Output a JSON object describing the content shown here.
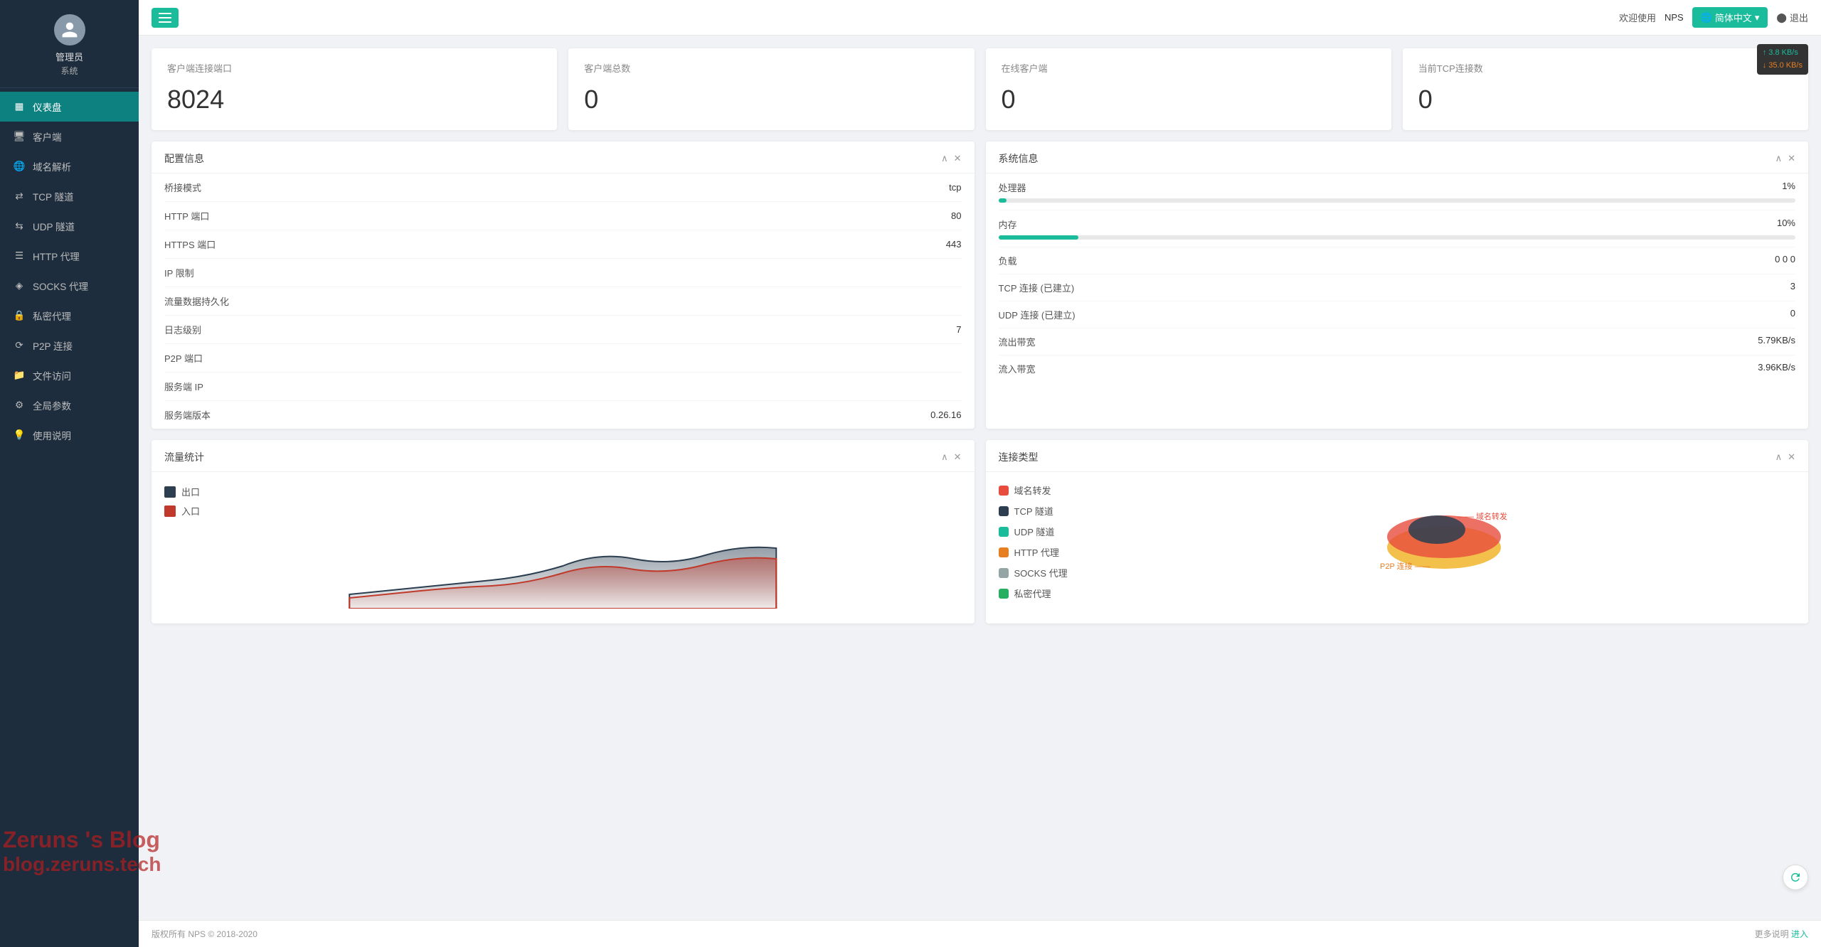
{
  "sidebar": {
    "user": {
      "name": "管理员",
      "role": "系统"
    },
    "nav": [
      {
        "id": "dashboard",
        "label": "仪表盘",
        "icon": "dashboard",
        "active": true
      },
      {
        "id": "clients",
        "label": "客户端",
        "icon": "clients",
        "active": false
      },
      {
        "id": "dns",
        "label": "域名解析",
        "icon": "dns",
        "active": false
      },
      {
        "id": "tcp",
        "label": "TCP 隧道",
        "icon": "tcp",
        "active": false
      },
      {
        "id": "udp",
        "label": "UDP 隧道",
        "icon": "udp",
        "active": false
      },
      {
        "id": "http",
        "label": "HTTP 代理",
        "icon": "http",
        "active": false
      },
      {
        "id": "socks",
        "label": "SOCKS 代理",
        "icon": "socks",
        "active": false
      },
      {
        "id": "private",
        "label": "私密代理",
        "icon": "private",
        "active": false
      },
      {
        "id": "p2p",
        "label": "P2P 连接",
        "icon": "p2p",
        "active": false
      },
      {
        "id": "file",
        "label": "文件访问",
        "icon": "file",
        "active": false
      },
      {
        "id": "global",
        "label": "全局参数",
        "icon": "global",
        "active": false
      },
      {
        "id": "docs",
        "label": "使用说明",
        "icon": "docs",
        "active": false
      }
    ]
  },
  "topbar": {
    "welcome": "欢迎使用",
    "brand": "NPS",
    "lang": "简体中文",
    "logout": "退出",
    "toggle_label": "菜单"
  },
  "stats": [
    {
      "label": "客户端连接端口",
      "value": "8024"
    },
    {
      "label": "客户端总数",
      "value": "0"
    },
    {
      "label": "在线客户端",
      "value": "0"
    },
    {
      "label": "当前TCP连接数",
      "value": "0"
    }
  ],
  "config": {
    "title": "配置信息",
    "rows": [
      {
        "key": "桥接模式",
        "value": "tcp"
      },
      {
        "key": "HTTP 端口",
        "value": "80"
      },
      {
        "key": "HTTPS 端口",
        "value": "443"
      },
      {
        "key": "IP 限制",
        "value": ""
      },
      {
        "key": "流量数据持久化",
        "value": ""
      },
      {
        "key": "日志级别",
        "value": "7"
      },
      {
        "key": "P2P 端口",
        "value": ""
      },
      {
        "key": "服务端 IP",
        "value": ""
      },
      {
        "key": "服务端版本",
        "value": "0.26.16"
      }
    ]
  },
  "sysinfo": {
    "title": "系统信息",
    "cpu": {
      "label": "处理器",
      "pct": 1,
      "bar_pct": 1,
      "display": "1%"
    },
    "mem": {
      "label": "内存",
      "pct": 10,
      "bar_pct": 10,
      "display": "10%"
    },
    "load": {
      "label": "负载",
      "value": "0  0  0"
    },
    "tcp_conn": {
      "label": "TCP 连接 (已建立)",
      "value": "3"
    },
    "udp_conn": {
      "label": "UDP 连接 (已建立)",
      "value": "0"
    },
    "outbound": {
      "label": "流出带宽",
      "value": "5.79KB/s"
    },
    "inbound": {
      "label": "流入带宽",
      "value": "3.96KB/s"
    }
  },
  "traffic": {
    "title": "流量统计",
    "legend": [
      {
        "label": "出口",
        "color": "#2c3e50"
      },
      {
        "label": "入口",
        "color": "#c0392b"
      }
    ]
  },
  "connection_types": {
    "title": "连接类型",
    "items": [
      {
        "label": "域名转发",
        "color": "#e74c3c"
      },
      {
        "label": "TCP 隧道",
        "color": "#2c3e50"
      },
      {
        "label": "UDP 隧道",
        "color": "#1abc9c"
      },
      {
        "label": "HTTP 代理",
        "color": "#e67e22"
      },
      {
        "label": "SOCKS 代理",
        "color": "#95a5a6"
      },
      {
        "label": "私密代理",
        "color": "#27ae60"
      }
    ],
    "chart_labels": [
      "P2P 连接",
      "域名转发"
    ]
  },
  "speed_badge": {
    "up": "↑ 3.8 KB/s",
    "down": "↓ 35.0 KB/s"
  },
  "footer": {
    "copyright": "版权所有 NPS © 2018-2020",
    "more": "更多说明",
    "enter": "进入"
  },
  "watermark": {
    "line1": "Zeruns 's Blog",
    "line2": "blog.zeruns.tech"
  }
}
